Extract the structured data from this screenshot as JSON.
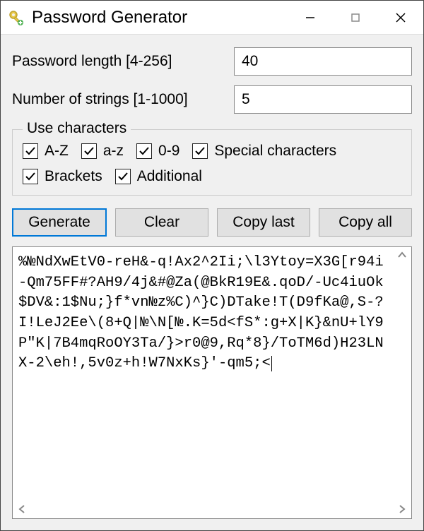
{
  "title": "Password Generator",
  "fields": {
    "length_label": "Password length [4-256]",
    "length_value": "40",
    "count_label": "Number of strings [1-1000]",
    "count_value": "5"
  },
  "group": {
    "legend": "Use characters",
    "items": {
      "az_upper": "A-Z",
      "az_lower": "a-z",
      "digits": "0-9",
      "special": "Special characters",
      "brackets": "Brackets",
      "additional": "Additional"
    }
  },
  "buttons": {
    "generate": "Generate",
    "clear": "Clear",
    "copy_last": "Copy last",
    "copy_all": "Copy all"
  },
  "output": "%№NdXwEtV0-reH&-q!Ax2^2Ii;\\l3Ytoy=X3G[r94i-Qm75FF#?AH9/4j&#@Za(@BkR19E&.qoD/-Uc4iuOk$DV&:1$Nu;}f*vn№z%C)^}C)DTake!T(D9fKa@,S-?I!LeJ2Ee\\(8+Q|№\\N[№.K=5d<fS*:g+X|K}&nU+lY9P\"K|7B4mqRoOY3Ta/}>r0@9,Rq*8}/ToTM6d)H23LNX-2\\eh!,5v0z+h!W7NxKs}'-qm5;<"
}
